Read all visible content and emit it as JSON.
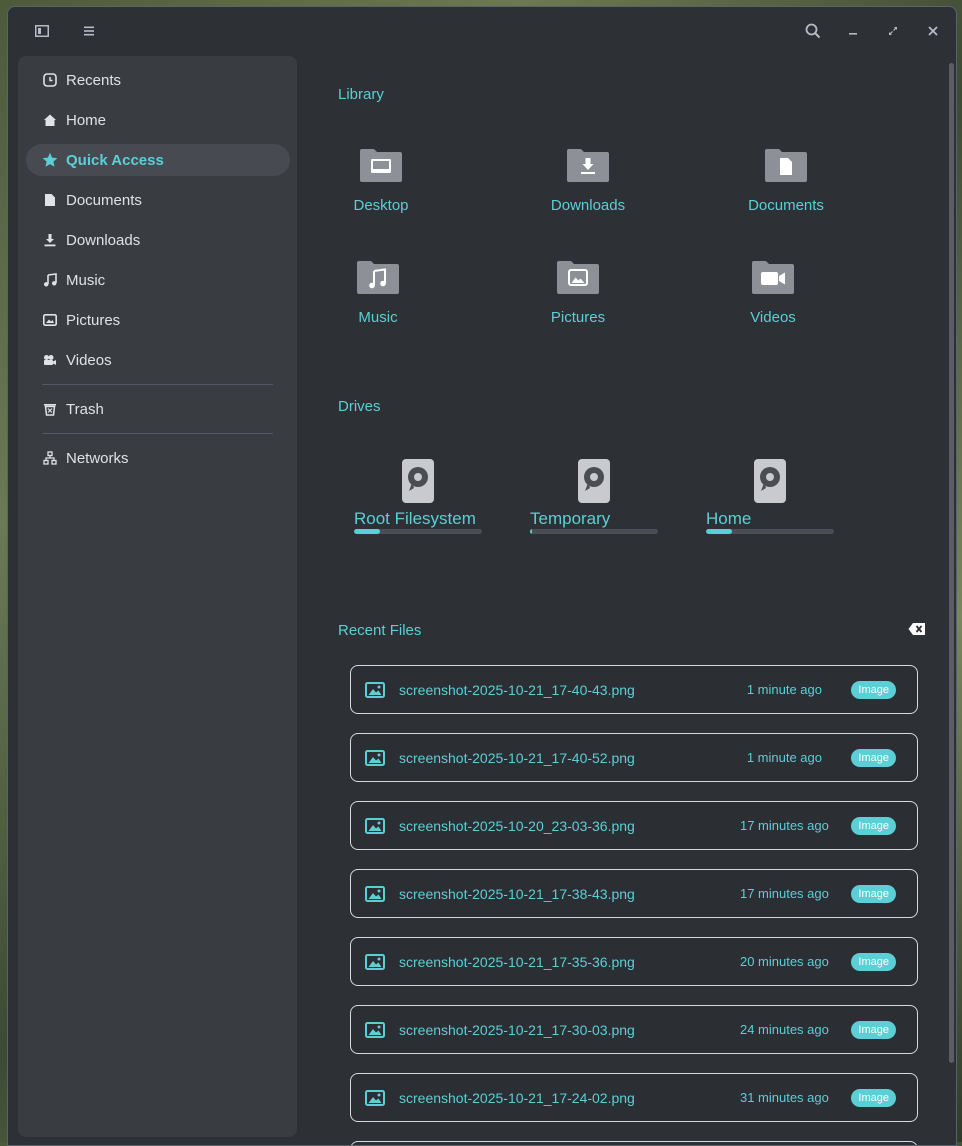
{
  "titlebar": {
    "sidebar_toggle_icon": "sidebar-toggle-icon",
    "menu_icon": "menu-icon",
    "search_icon": "search-icon",
    "minimize_icon": "minimize-icon",
    "restore_icon": "restore-icon",
    "close_icon": "close-icon"
  },
  "sidebar": {
    "items": [
      {
        "label": "Recents",
        "icon": "clock-icon"
      },
      {
        "label": "Home",
        "icon": "home-icon"
      },
      {
        "label": "Quick Access",
        "icon": "star-icon",
        "active": true
      },
      {
        "label": "Documents",
        "icon": "document-icon"
      },
      {
        "label": "Downloads",
        "icon": "download-icon"
      },
      {
        "label": "Music",
        "icon": "music-icon"
      },
      {
        "label": "Pictures",
        "icon": "picture-icon"
      },
      {
        "label": "Videos",
        "icon": "video-icon"
      },
      {
        "label": "Trash",
        "icon": "trash-icon"
      },
      {
        "label": "Networks",
        "icon": "network-icon"
      }
    ]
  },
  "main": {
    "library_title": "Library",
    "library": [
      {
        "label": "Desktop",
        "icon": "desktop-folder-icon"
      },
      {
        "label": "Downloads",
        "icon": "downloads-folder-icon"
      },
      {
        "label": "Documents",
        "icon": "documents-folder-icon"
      },
      {
        "label": "Music",
        "icon": "music-folder-icon"
      },
      {
        "label": "Pictures",
        "icon": "pictures-folder-icon"
      },
      {
        "label": "Videos",
        "icon": "videos-folder-icon"
      }
    ],
    "drives_title": "Drives",
    "drives": [
      {
        "label": "Root Filesystem",
        "usage": 0.2
      },
      {
        "label": "Temporary",
        "usage": 0.01
      },
      {
        "label": "Home",
        "usage": 0.2
      }
    ],
    "recent_title": "Recent Files",
    "clear_icon": "clear-icon",
    "recent_files": [
      {
        "name": "screenshot-2025-10-21_17-40-43.png",
        "time": "1 minute ago",
        "type": "Image"
      },
      {
        "name": "screenshot-2025-10-21_17-40-52.png",
        "time": "1 minute ago",
        "type": "Image"
      },
      {
        "name": "screenshot-2025-10-20_23-03-36.png",
        "time": "17 minutes ago",
        "type": "Image"
      },
      {
        "name": "screenshot-2025-10-21_17-38-43.png",
        "time": "17 minutes ago",
        "type": "Image"
      },
      {
        "name": "screenshot-2025-10-21_17-35-36.png",
        "time": "20 minutes ago",
        "type": "Image"
      },
      {
        "name": "screenshot-2025-10-21_17-30-03.png",
        "time": "24 minutes ago",
        "type": "Image"
      },
      {
        "name": "screenshot-2025-10-21_17-24-02.png",
        "time": "31 minutes ago",
        "type": "Image"
      }
    ]
  },
  "colors": {
    "accent": "#5ccfd6",
    "window_bg": "#2d3035",
    "sidebar_bg": "#393c41"
  }
}
